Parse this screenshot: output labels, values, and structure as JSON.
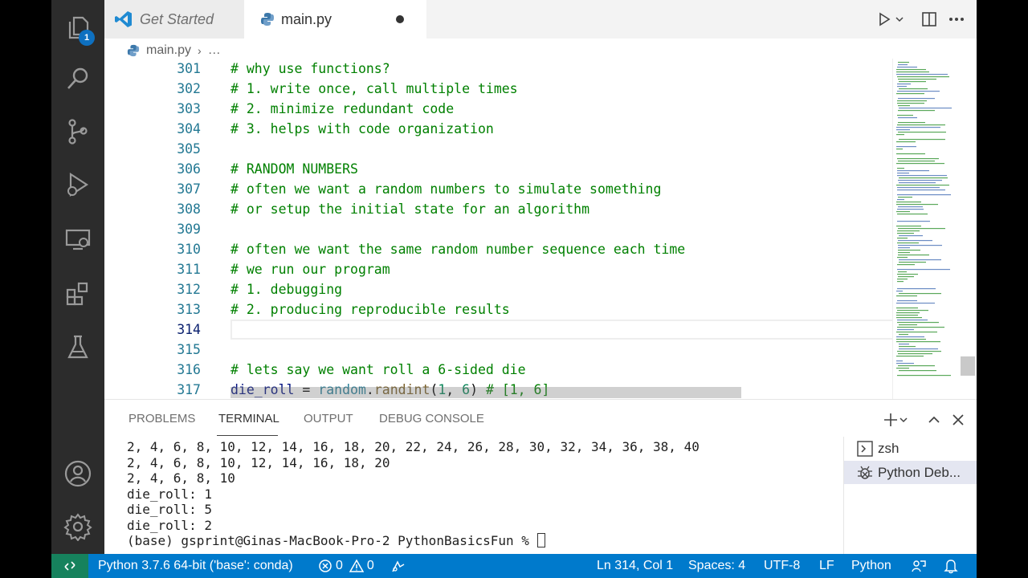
{
  "tabs": {
    "get_started": "Get Started",
    "main": "main.py"
  },
  "breadcrumb": {
    "file": "main.py",
    "rest": "…"
  },
  "activity": {
    "explorer_badge": "1"
  },
  "editor": {
    "lines": [
      {
        "num": "301",
        "text": "# why use functions?"
      },
      {
        "num": "302",
        "text": "# 1. write once, call multiple times"
      },
      {
        "num": "303",
        "text": "# 2. minimize redundant code"
      },
      {
        "num": "304",
        "text": "# 3. helps with code organization"
      },
      {
        "num": "305",
        "text": ""
      },
      {
        "num": "306",
        "text": "# RANDOM NUMBERS"
      },
      {
        "num": "307",
        "text": "# often we want a random numbers to simulate something"
      },
      {
        "num": "308",
        "text": "# or setup the initial state for an algorithm"
      },
      {
        "num": "309",
        "text": ""
      },
      {
        "num": "310",
        "text": "# often we want the same random number sequence each time"
      },
      {
        "num": "311",
        "text": "# we run our program"
      },
      {
        "num": "312",
        "text": "# 1. debugging"
      },
      {
        "num": "313",
        "text": "# 2. producing reproducible results"
      },
      {
        "num": "314",
        "text": ""
      },
      {
        "num": "315",
        "text": ""
      },
      {
        "num": "316",
        "text": "# lets say we want roll a 6-sided die"
      }
    ],
    "line317": {
      "num": "317",
      "var": "die_roll",
      "eq": " = ",
      "mod": "random",
      "dot": ".",
      "fn": "randint",
      "open": "(",
      "a": "1",
      "comma": ", ",
      "b": "6",
      "close": ")",
      "comment": " # [1, 6]"
    }
  },
  "panel": {
    "tabs": [
      "PROBLEMS",
      "TERMINAL",
      "OUTPUT",
      "DEBUG CONSOLE"
    ],
    "terminal_lines": [
      "2, 4, 6, 8, 10, 12, 14, 16, 18, 20, 22, 24, 26, 28, 30, 32, 34, 36, 38, 40",
      "2, 4, 6, 8, 10, 12, 14, 16, 18, 20",
      "2, 4, 6, 8, 10",
      "die_roll: 1",
      "die_roll: 5",
      "die_roll: 2"
    ],
    "prompt": "(base) gsprint@Ginas-MacBook-Pro-2 PythonBasicsFun % ",
    "terminals": [
      "zsh",
      "Python Deb..."
    ]
  },
  "status": {
    "interpreter": "Python 3.7.6 64-bit ('base': conda)",
    "errors": "0",
    "warnings": "0",
    "position": "Ln 314, Col 1",
    "spaces": "Spaces: 4",
    "encoding": "UTF-8",
    "eol": "LF",
    "language": "Python"
  },
  "colors": {
    "status_bar": "#007acc",
    "remote": "#16825d",
    "comment": "#008000",
    "line_number": "#237893",
    "activity_bar": "#2c2c2c"
  }
}
